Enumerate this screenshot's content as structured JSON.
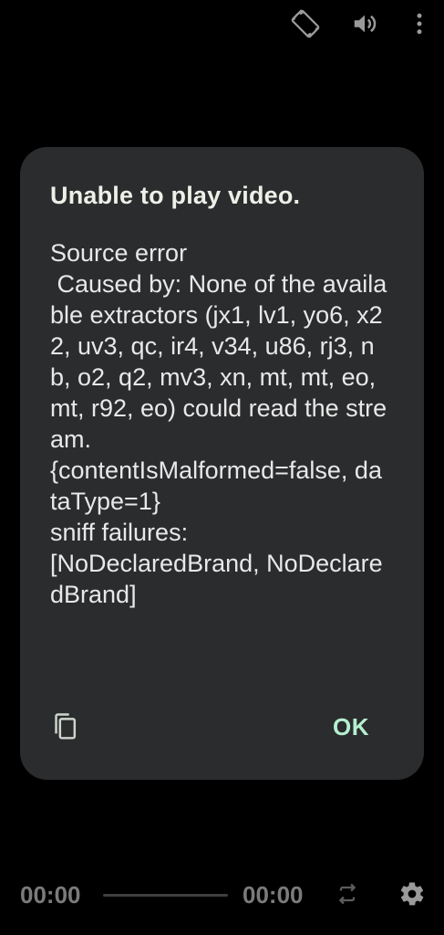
{
  "top_controls": {
    "rotate_icon": "screen-rotation-icon",
    "volume_icon": "volume-up-icon",
    "more_icon": "more-vertical-icon"
  },
  "dialog": {
    "title": "Unable to play video.",
    "message": "Source error\n Caused by: None of the available extractors (jx1, lv1, yo6, x22, uv3, qc, ir4, v34, u86, rj3, nb, o2, q2, mv3, xn, mt, mt, eo, mt, r92, eo) could read the stream.\n{contentIsMalformed=false, dataType=1}\nsniff failures:\n[NoDeclaredBrand, NoDeclaredBrand]",
    "copy_icon": "copy-icon",
    "ok_label": "OK"
  },
  "bottom_bar": {
    "current_time": "00:00",
    "total_time": "00:00",
    "repeat_icon": "repeat-icon",
    "settings_icon": "settings-gear-icon"
  },
  "colors": {
    "background": "#000000",
    "dialog_background": "#2b2c2e",
    "accent": "#b5efd0",
    "muted_text": "#7b7b7b"
  }
}
